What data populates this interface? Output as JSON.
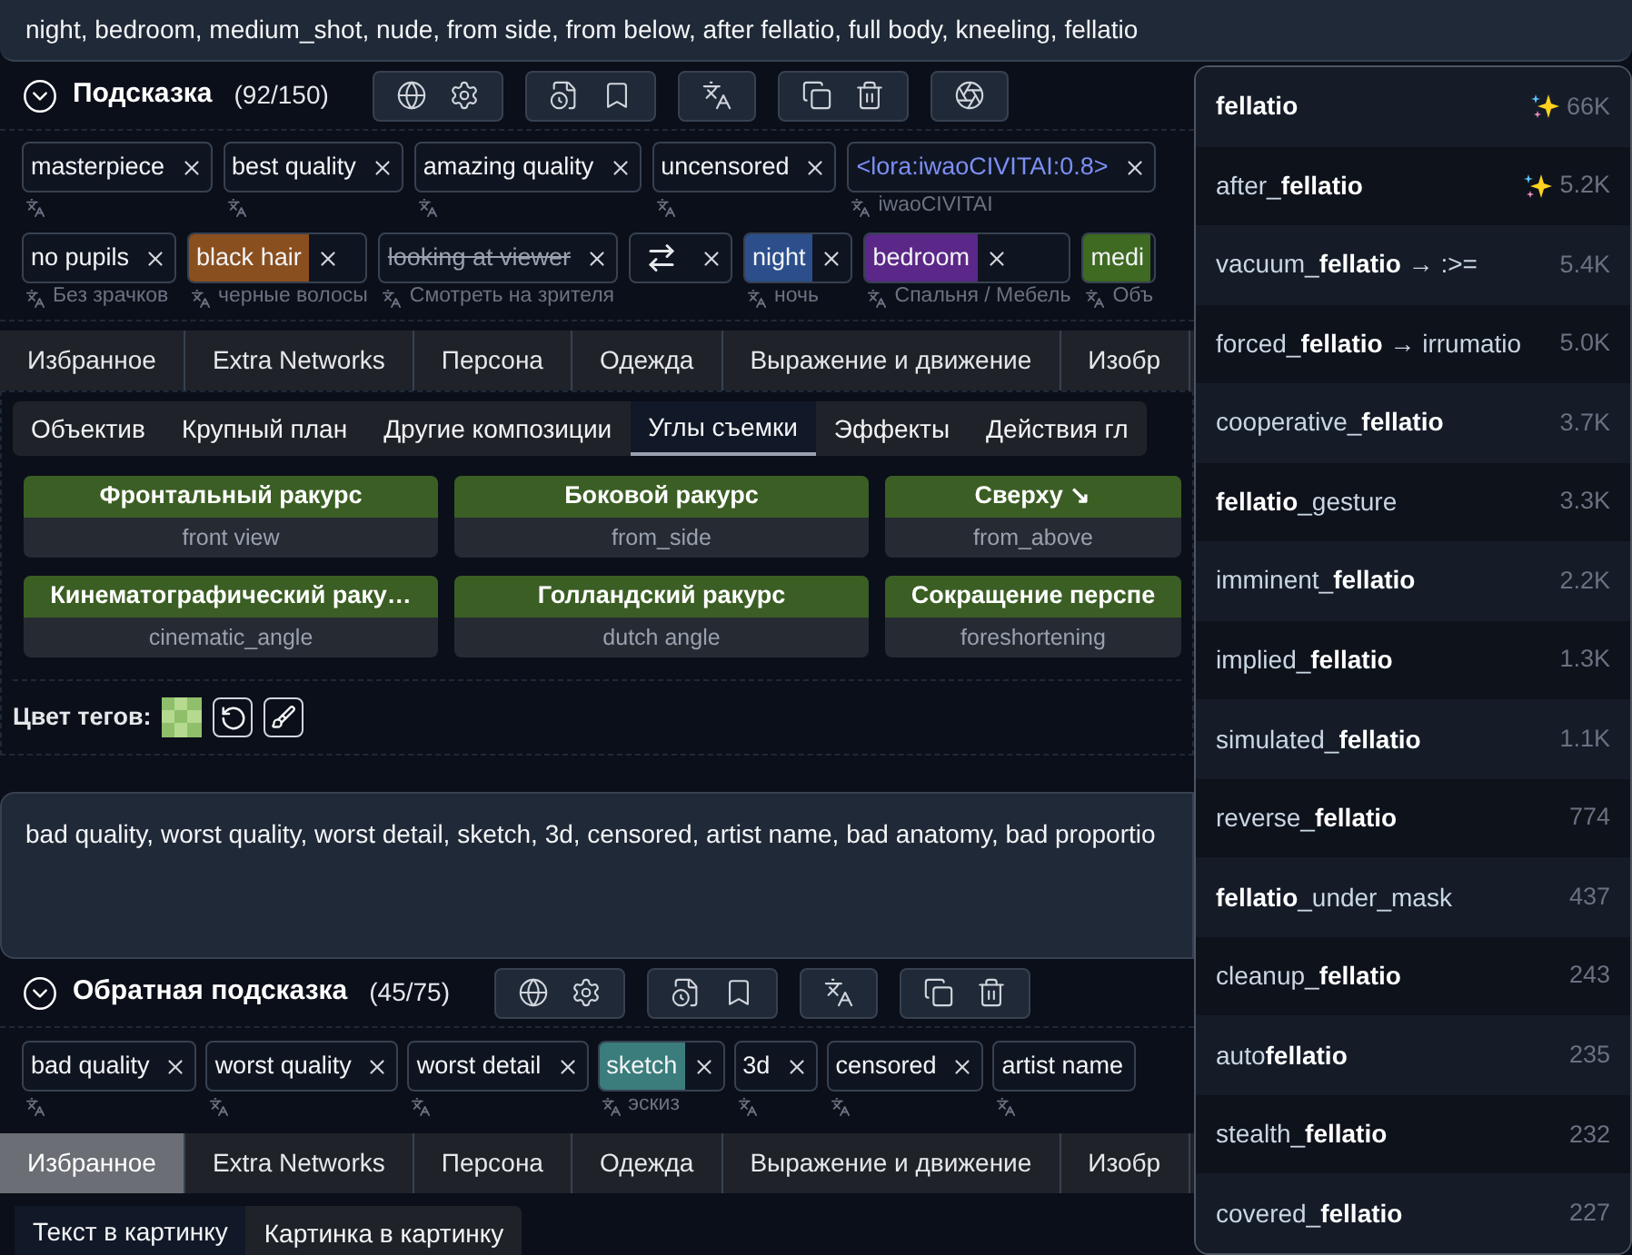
{
  "prompt_text": "night, bedroom, medium_shot, nude, from side, from below, after fellatio, full body, kneeling, fellatio",
  "prompt": {
    "title": "Подсказка",
    "count": "(92/150)",
    "toolbar": [
      [
        {
          "kind": "globe"
        },
        {
          "kind": "settings"
        }
      ],
      [
        {
          "kind": "history"
        },
        {
          "kind": "bookmark"
        }
      ],
      [
        {
          "kind": "translate"
        }
      ],
      [
        {
          "kind": "copy"
        },
        {
          "kind": "trash"
        }
      ],
      [
        {
          "kind": "aperture"
        }
      ]
    ],
    "tag_rows": [
      [
        {
          "kind": "text",
          "text": "masterpiece",
          "removable": true
        },
        {
          "kind": "text",
          "text": "best quality",
          "removable": true
        },
        {
          "kind": "text",
          "text": "amazing quality",
          "removable": true
        },
        {
          "kind": "text",
          "text": "uncensored",
          "removable": true
        },
        {
          "kind": "lora",
          "text": "<lora:iwaoCIVITAI:0.8>",
          "sub": "iwaoCIVITAI",
          "removable": true
        }
      ],
      [
        {
          "kind": "text",
          "text": "no pupils",
          "sub": "Без зрачков",
          "removable": true
        },
        {
          "kind": "text",
          "text": "black hair",
          "sub": "черные волосы",
          "color": "#8a4f1f",
          "removable": true
        },
        {
          "kind": "text",
          "text": "looking at viewer",
          "sub": "Смотреть на зрителя",
          "disabled": true,
          "removable": true
        },
        {
          "kind": "icon",
          "removable": true
        },
        {
          "kind": "text",
          "text": "night",
          "sub": "ночь",
          "color": "#2c4f8c",
          "removable": true
        },
        {
          "kind": "text",
          "text": "bedroom",
          "sub": "Спальня / Мебель",
          "color": "#5b2788",
          "removable": true
        },
        {
          "kind": "text",
          "text": "medi",
          "sub": "Объ",
          "color": "#3e6a22",
          "removable": false
        }
      ]
    ],
    "tabs": [
      {
        "label": "Избранное",
        "selected": false
      },
      {
        "label": "Extra Networks",
        "selected": false
      },
      {
        "label": "Персона",
        "selected": false
      },
      {
        "label": "Одежда",
        "selected": false
      },
      {
        "label": "Выражение и движение",
        "selected": false
      },
      {
        "label": "Изобр",
        "selected": false
      }
    ],
    "subtabs": [
      {
        "label": "Объектив",
        "selected": false
      },
      {
        "label": "Крупный план",
        "selected": false
      },
      {
        "label": "Другие композиции",
        "selected": false
      },
      {
        "label": "Углы съемки",
        "selected": true
      },
      {
        "label": "Эффекты",
        "selected": false
      },
      {
        "label": "Действия гл",
        "selected": false
      }
    ],
    "cards": [
      {
        "title": "Фронтальный ракурс",
        "tag": "front view"
      },
      {
        "title": "Боковой ракурс",
        "tag": "from_side"
      },
      {
        "title": "Сверху ↘",
        "tag": "from_above"
      },
      {
        "title": "Кинематографический раку…",
        "tag": "cinematic_angle"
      },
      {
        "title": "Голландский ракурс",
        "tag": "dutch angle"
      },
      {
        "title": "Сокращение перспе",
        "tag": "foreshortening"
      }
    ],
    "tag_color_label": "Цвет тегов:"
  },
  "negative_text": "bad quality, worst quality, worst detail, sketch, 3d, censored, artist name, bad anatomy, bad proportio",
  "negative": {
    "title": "Обратная подсказка",
    "count": "(45/75)",
    "toolbar": [
      [
        {
          "kind": "globe"
        },
        {
          "kind": "settings"
        }
      ],
      [
        {
          "kind": "history"
        },
        {
          "kind": "bookmark"
        }
      ],
      [
        {
          "kind": "translate"
        }
      ],
      [
        {
          "kind": "copy"
        },
        {
          "kind": "trash"
        }
      ]
    ],
    "tags": [
      {
        "kind": "text",
        "text": "bad quality",
        "removable": true
      },
      {
        "kind": "text",
        "text": "worst quality",
        "removable": true
      },
      {
        "kind": "text",
        "text": "worst detail",
        "removable": true
      },
      {
        "kind": "text",
        "text": "sketch",
        "sub": "эскиз",
        "color": "#3b7c7c",
        "removable": true
      },
      {
        "kind": "text",
        "text": "3d",
        "removable": true
      },
      {
        "kind": "text",
        "text": "censored",
        "removable": true
      },
      {
        "kind": "text",
        "text": "artist name",
        "removable": false
      }
    ],
    "tabs": [
      {
        "label": "Избранное",
        "selected": true
      },
      {
        "label": "Extra Networks",
        "selected": false
      },
      {
        "label": "Персона",
        "selected": false
      },
      {
        "label": "Одежда",
        "selected": false
      },
      {
        "label": "Выражение и движение",
        "selected": false
      },
      {
        "label": "Изобр",
        "selected": false
      }
    ],
    "subtabs": [
      {
        "label": "Текст в картинку",
        "selected": true
      },
      {
        "label": "Картинка в картинку",
        "selected": false
      }
    ]
  },
  "suggestions": [
    {
      "name": "**fellatio**",
      "count": "66K",
      "sparkle": true
    },
    {
      "name": "after_**fellatio**",
      "count": "5.2K",
      "sparkle": true
    },
    {
      "name": "vacuum_**fellatio** → :>=",
      "count": "5.4K",
      "sparkle": false
    },
    {
      "name": "forced_**fellatio** → irrumatio",
      "count": "5.0K",
      "sparkle": false
    },
    {
      "name": "cooperative_**fellatio**",
      "count": "3.7K",
      "sparkle": false
    },
    {
      "name": "**fellatio**_gesture",
      "count": "3.3K",
      "sparkle": false
    },
    {
      "name": "imminent_**fellatio**",
      "count": "2.2K",
      "sparkle": false
    },
    {
      "name": "implied_**fellatio**",
      "count": "1.3K",
      "sparkle": false
    },
    {
      "name": "simulated_**fellatio**",
      "count": "1.1K",
      "sparkle": false
    },
    {
      "name": "reverse_**fellatio**",
      "count": "774",
      "sparkle": false
    },
    {
      "name": "**fellatio**_under_mask",
      "count": "437",
      "sparkle": false
    },
    {
      "name": "cleanup_**fellatio**",
      "count": "243",
      "sparkle": false
    },
    {
      "name": "auto**fellatio**",
      "count": "235",
      "sparkle": false
    },
    {
      "name": "stealth_**fellatio**",
      "count": "232",
      "sparkle": false
    },
    {
      "name": "covered_**fellatio**",
      "count": "227",
      "sparkle": false
    }
  ]
}
